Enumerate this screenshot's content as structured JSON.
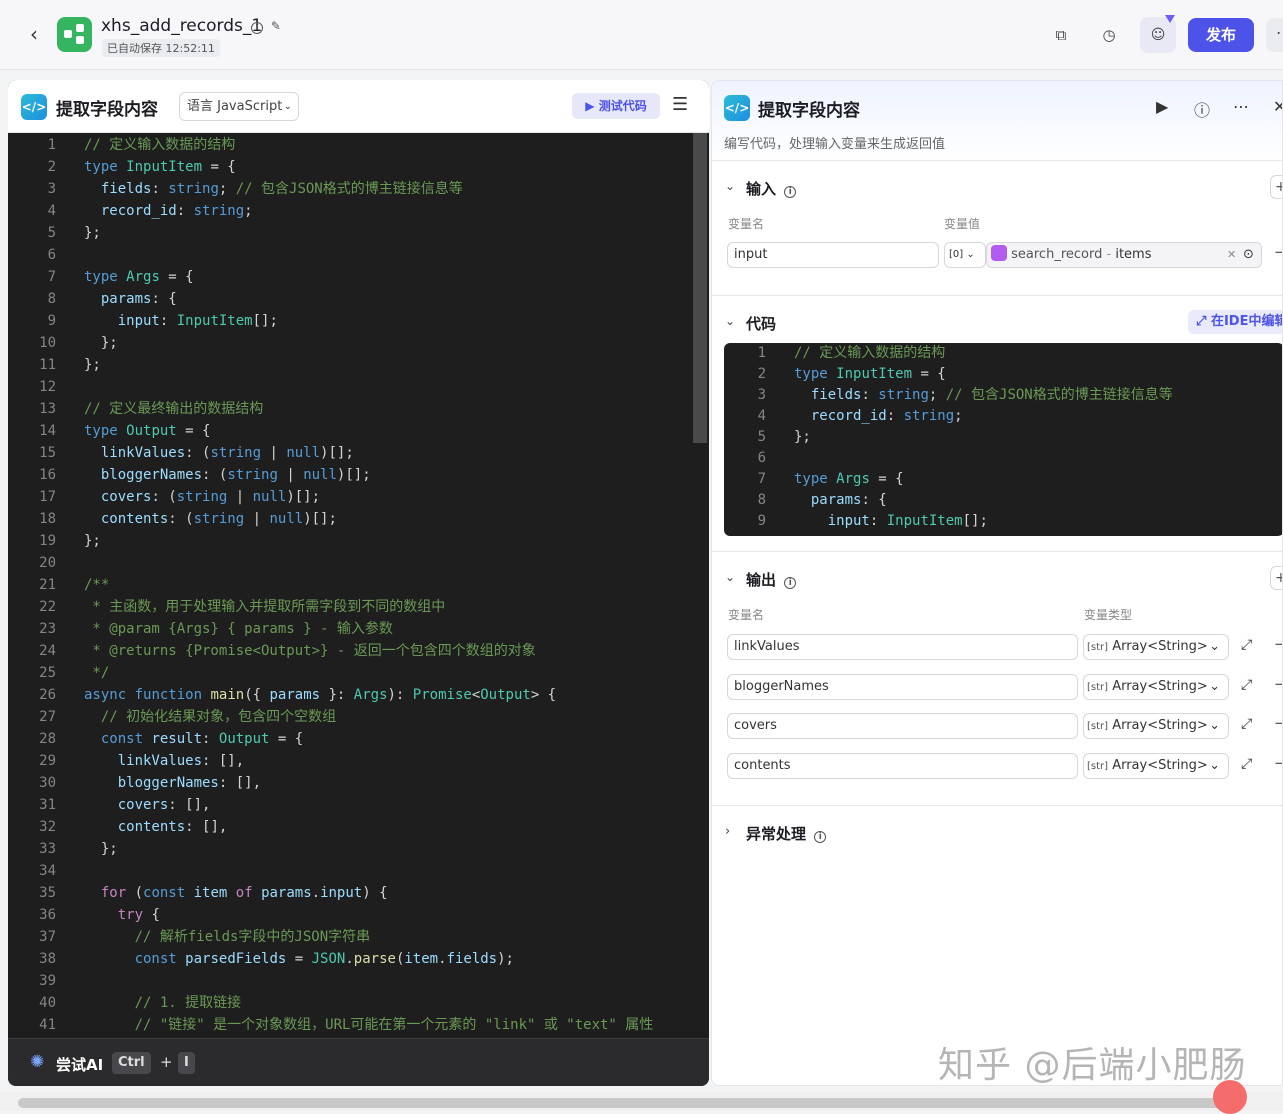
{
  "topbar": {
    "title": "xhs_add_records_1",
    "autosave": "已自动保存 12:52:11",
    "publish": "发布"
  },
  "left": {
    "title": "提取字段内容",
    "language": "语言 JavaScript",
    "test_button": "测试代码",
    "ai_label": "尝试AI",
    "key_ctrl": "Ctrl",
    "key_plus": "+",
    "key_i": "I",
    "code_lines": [
      {
        "n": "1",
        "t": "// 定义输入数据的结构"
      },
      {
        "n": "2",
        "t": "type InputItem = {"
      },
      {
        "n": "3",
        "t": "  fields: string; // 包含JSON格式的博主链接信息等"
      },
      {
        "n": "4",
        "t": "  record_id: string;"
      },
      {
        "n": "5",
        "t": "};"
      },
      {
        "n": "6",
        "t": ""
      },
      {
        "n": "7",
        "t": "type Args = {"
      },
      {
        "n": "8",
        "t": "  params: {"
      },
      {
        "n": "9",
        "t": "    input: InputItem[];"
      },
      {
        "n": "10",
        "t": "  };"
      },
      {
        "n": "11",
        "t": "};"
      },
      {
        "n": "12",
        "t": ""
      },
      {
        "n": "13",
        "t": "// 定义最终输出的数据结构"
      },
      {
        "n": "14",
        "t": "type Output = {"
      },
      {
        "n": "15",
        "t": "  linkValues: (string | null)[];"
      },
      {
        "n": "16",
        "t": "  bloggerNames: (string | null)[];"
      },
      {
        "n": "17",
        "t": "  covers: (string | null)[];"
      },
      {
        "n": "18",
        "t": "  contents: (string | null)[];"
      },
      {
        "n": "19",
        "t": "};"
      },
      {
        "n": "20",
        "t": ""
      },
      {
        "n": "21",
        "t": "/**"
      },
      {
        "n": "22",
        "t": " * 主函数，用于处理输入并提取所需字段到不同的数组中"
      },
      {
        "n": "23",
        "t": " * @param {Args} { params } - 输入参数"
      },
      {
        "n": "24",
        "t": " * @returns {Promise<Output>} - 返回一个包含四个数组的对象"
      },
      {
        "n": "25",
        "t": " */"
      },
      {
        "n": "26",
        "t": "async function main({ params }: Args): Promise<Output> {"
      },
      {
        "n": "27",
        "t": "  // 初始化结果对象，包含四个空数组"
      },
      {
        "n": "28",
        "t": "  const result: Output = {"
      },
      {
        "n": "29",
        "t": "    linkValues: [],"
      },
      {
        "n": "30",
        "t": "    bloggerNames: [],"
      },
      {
        "n": "31",
        "t": "    covers: [],"
      },
      {
        "n": "32",
        "t": "    contents: [],"
      },
      {
        "n": "33",
        "t": "  };"
      },
      {
        "n": "34",
        "t": ""
      },
      {
        "n": "35",
        "t": "  for (const item of params.input) {"
      },
      {
        "n": "36",
        "t": "    try {"
      },
      {
        "n": "37",
        "t": "      // 解析fields字段中的JSON字符串"
      },
      {
        "n": "38",
        "t": "      const parsedFields = JSON.parse(item.fields);"
      },
      {
        "n": "39",
        "t": ""
      },
      {
        "n": "40",
        "t": "      // 1. 提取链接"
      },
      {
        "n": "41",
        "t": "      // \"链接\" 是一个对象数组，URL可能在第一个元素的 \"link\" 或 \"text\" 属性"
      }
    ]
  },
  "right": {
    "title": "提取字段内容",
    "description": "编写代码，处理输入变量来生成返回值",
    "input_section": "输入",
    "col_var_name": "变量名",
    "col_var_value": "变量值",
    "input_name": "input",
    "input_type_icon": "[0]",
    "ref_node": "search_record",
    "ref_sep": "-",
    "ref_field": "items",
    "code_section": "代码",
    "ide_button": "在IDE中编辑",
    "mini_code_lines": [
      {
        "n": "1",
        "t": "// 定义输入数据的结构"
      },
      {
        "n": "2",
        "t": "type InputItem = {"
      },
      {
        "n": "3",
        "t": "  fields: string; // 包含JSON格式的博主链接信息等"
      },
      {
        "n": "4",
        "t": "  record_id: string;"
      },
      {
        "n": "5",
        "t": "};"
      },
      {
        "n": "6",
        "t": ""
      },
      {
        "n": "7",
        "t": "type Args = {"
      },
      {
        "n": "8",
        "t": "  params: {"
      },
      {
        "n": "9",
        "t": "    input: InputItem[];"
      }
    ],
    "output_section": "输出",
    "col_out_name": "变量名",
    "col_out_type": "变量类型",
    "outputs": [
      {
        "name": "linkValues",
        "type_icon": "[str]",
        "type": "Array<String>"
      },
      {
        "name": "bloggerNames",
        "type_icon": "[str]",
        "type": "Array<String>"
      },
      {
        "name": "covers",
        "type_icon": "[str]",
        "type": "Array<String>"
      },
      {
        "name": "contents",
        "type_icon": "[str]",
        "type": "Array<String>"
      }
    ],
    "exception_section": "异常处理"
  },
  "watermark": "知乎 @后端小肥肠",
  "colors": {
    "accent": "#4d53e8",
    "editor_bg": "#1e1e1e",
    "green_icon": "#35b55f"
  }
}
